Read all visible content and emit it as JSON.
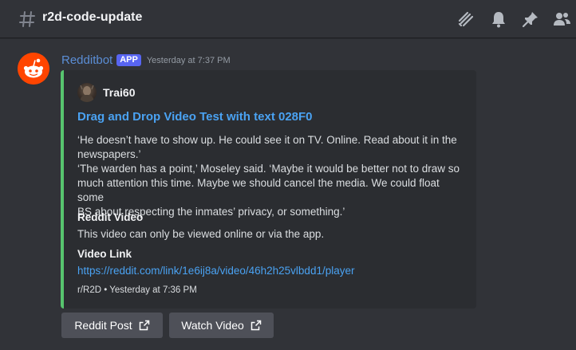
{
  "channel": {
    "name": "r2d-code-update"
  },
  "header_icons": [
    "threads-icon",
    "bell-icon",
    "pin-icon",
    "members-icon"
  ],
  "message": {
    "author": "Redditbot",
    "badge": "APP",
    "timestamp": "Yesterday at 7:37 PM",
    "avatar_color": "#ff4500"
  },
  "embed": {
    "accent_color": "#57c46e",
    "author_name": "Trai60",
    "title": "Drag and Drop Video Test with text 028F0",
    "description_lines": [
      "‘He doesn’t have to show up. He could see it on TV. Online. Read about it in the",
      "newspapers.’",
      "‘The warden has a point,’ Moseley said. ‘Maybe it would be better not to draw so",
      "much attention this time. Maybe we should cancel the media. We could float some",
      "BS about respecting the inmates’ privacy, or something.’"
    ],
    "fields": [
      {
        "name": "Reddit Video",
        "value": "This video can only be viewed online or via the app."
      },
      {
        "name": "Video Link",
        "value": "https://reddit.com/link/1e6ij8a/video/46h2h25vlbdd1/player"
      }
    ],
    "footer": "r/R2D • Yesterday at 7:36 PM"
  },
  "buttons": [
    {
      "label": "Reddit Post"
    },
    {
      "label": "Watch Video"
    }
  ]
}
